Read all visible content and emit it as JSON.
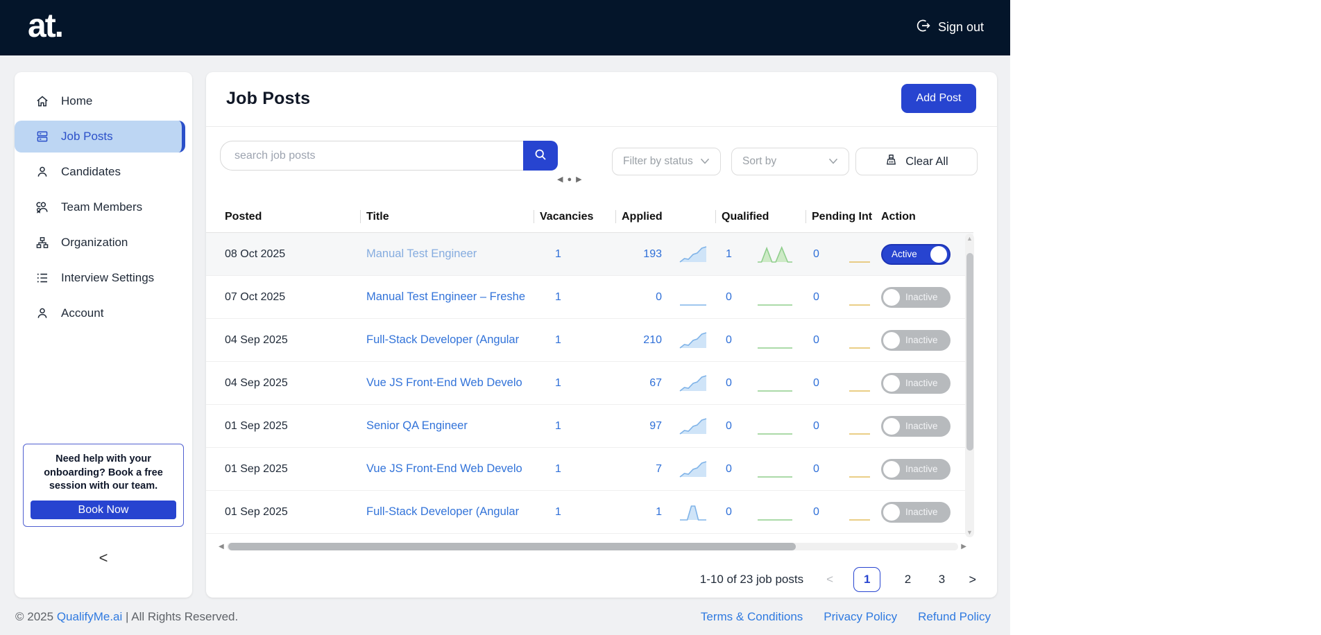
{
  "topbar": {
    "logo": "at.",
    "sign_out_label": "Sign out"
  },
  "sidebar": {
    "items": [
      {
        "label": "Home",
        "icon": "home-icon",
        "active": false
      },
      {
        "label": "Job Posts",
        "icon": "job-posts-icon",
        "active": true
      },
      {
        "label": "Candidates",
        "icon": "candidates-icon",
        "active": false
      },
      {
        "label": "Team Members",
        "icon": "team-members-icon",
        "active": false
      },
      {
        "label": "Organization",
        "icon": "organization-icon",
        "active": false
      },
      {
        "label": "Interview Settings",
        "icon": "interview-settings-icon",
        "active": false
      },
      {
        "label": "Account",
        "icon": "account-icon",
        "active": false
      }
    ],
    "help_text": "Need help with your onboarding? Book a free session with our team.",
    "book_now_label": "Book Now",
    "collapse_label": "<"
  },
  "main": {
    "title": "Job Posts",
    "add_post_label": "Add Post",
    "search": {
      "placeholder": "search job posts"
    },
    "carousel": {
      "prev": "◀",
      "dot": "●",
      "next": "▶"
    },
    "filters": {
      "status_label": "Filter by status",
      "sort_label": "Sort by",
      "clear_label": "Clear All"
    },
    "table": {
      "columns": [
        "Posted",
        "Title",
        "Vacancies",
        "Applied",
        "Qualified",
        "Pending Int",
        "Action"
      ],
      "rows": [
        {
          "posted": "08 Oct 2025",
          "title": "Manual Test Engineer",
          "title_tone": "light",
          "vacancies": "1",
          "applied": "193",
          "applied_trend": "rise",
          "qualified": "1",
          "qualified_trend": "twin-peaks",
          "pending": "0",
          "pending_trend": "flat",
          "status_label": "Active",
          "active": true,
          "highlight": true
        },
        {
          "posted": "07 Oct 2025",
          "title": "Manual Test Engineer – Freshe",
          "title_tone": "normal",
          "vacancies": "1",
          "applied": "0",
          "applied_trend": "flat",
          "qualified": "0",
          "qualified_trend": "flat",
          "pending": "0",
          "pending_trend": "flat",
          "status_label": "Inactive",
          "active": false,
          "highlight": false
        },
        {
          "posted": "04 Sep 2025",
          "title": "Full-Stack Developer (Angular",
          "title_tone": "normal",
          "vacancies": "1",
          "applied": "210",
          "applied_trend": "rise",
          "qualified": "0",
          "qualified_trend": "flat",
          "pending": "0",
          "pending_trend": "flat",
          "status_label": "Inactive",
          "active": false,
          "highlight": false
        },
        {
          "posted": "04 Sep 2025",
          "title": "Vue JS Front-End Web Develo",
          "title_tone": "normal",
          "vacancies": "1",
          "applied": "67",
          "applied_trend": "rise",
          "qualified": "0",
          "qualified_trend": "flat",
          "pending": "0",
          "pending_trend": "flat",
          "status_label": "Inactive",
          "active": false,
          "highlight": false
        },
        {
          "posted": "01 Sep 2025",
          "title": "Senior QA Engineer",
          "title_tone": "normal",
          "vacancies": "1",
          "applied": "97",
          "applied_trend": "rise",
          "qualified": "0",
          "qualified_trend": "flat",
          "pending": "0",
          "pending_trend": "flat",
          "status_label": "Inactive",
          "active": false,
          "highlight": false
        },
        {
          "posted": "01 Sep 2025",
          "title": "Vue JS Front-End Web Develo",
          "title_tone": "normal",
          "vacancies": "1",
          "applied": "7",
          "applied_trend": "rise",
          "qualified": "0",
          "qualified_trend": "flat",
          "pending": "0",
          "pending_trend": "flat",
          "status_label": "Inactive",
          "active": false,
          "highlight": false
        },
        {
          "posted": "01 Sep 2025",
          "title": "Full-Stack Developer (Angular",
          "title_tone": "normal",
          "vacancies": "1",
          "applied": "1",
          "applied_trend": "peak",
          "qualified": "0",
          "qualified_trend": "flat",
          "pending": "0",
          "pending_trend": "flat",
          "status_label": "Inactive",
          "active": false,
          "highlight": false
        }
      ]
    },
    "pagination": {
      "summary": "1-10 of 23 job posts",
      "prev": "<",
      "next": ">",
      "pages": [
        "1",
        "2",
        "3"
      ],
      "current": "1"
    }
  },
  "footer": {
    "copyright_prefix": "© 2025",
    "brand": "QualifyMe.ai",
    "copyright_suffix": "| All Rights Reserved.",
    "links": [
      "Terms & Conditions",
      "Privacy Policy",
      "Refund Policy"
    ]
  },
  "colors": {
    "primary_blue": "#2744d0",
    "topbar_navy": "#04152a",
    "active_nav_bg": "#bdd6f3",
    "active_nav_text": "#2b50c9",
    "link_blue": "#3273d9",
    "link_light_blue": "#85acdf",
    "spark_blue": "#7fb3e8",
    "spark_green": "#8fce8c",
    "spark_amber": "#e4bd5f"
  }
}
